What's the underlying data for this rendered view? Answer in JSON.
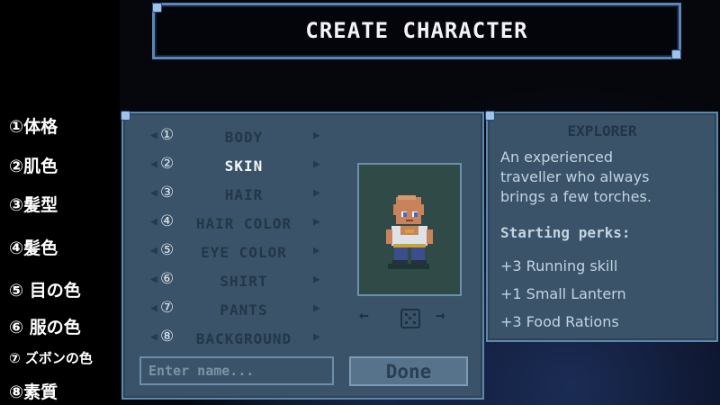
{
  "annotations": [
    "①体格",
    "②肌色",
    "③髪型",
    "④髪色",
    "⑤ 目の色",
    "⑥ 服の色",
    "⑦ ズボンの色",
    "⑧素質"
  ],
  "title": "CREATE CHARACTER",
  "options": [
    {
      "num": "①",
      "label": "BODY",
      "active": false
    },
    {
      "num": "②",
      "label": "SKIN",
      "active": true
    },
    {
      "num": "③",
      "label": "HAIR",
      "active": false
    },
    {
      "num": "④",
      "label": "HAIR COLOR",
      "active": false
    },
    {
      "num": "⑤",
      "label": "EYE COLOR",
      "active": false
    },
    {
      "num": "⑥",
      "label": "SHIRT",
      "active": false
    },
    {
      "num": "⑦",
      "label": "PANTS",
      "active": false
    },
    {
      "num": "⑧",
      "label": "BACKGROUND",
      "active": false
    }
  ],
  "arrows": {
    "left": "◀",
    "right": "▶"
  },
  "preview_controls": {
    "prev": "←",
    "next": "→",
    "randomize_icon": "dice-icon"
  },
  "name_input": {
    "placeholder": "Enter name...",
    "value": ""
  },
  "done_label": "Done",
  "info": {
    "title": "EXPLORER",
    "description_lines": [
      "An experienced",
      "traveller who always",
      "brings a few torches."
    ],
    "perks_title": "Starting perks:",
    "perks": [
      "+3 Running skill",
      "+1 Small Lantern",
      "+3 Food Rations"
    ]
  },
  "colors": {
    "panel": "#3a5368",
    "panel_border": "#5f87ab",
    "preview_bg": "#2f4a47",
    "text_light": "#c3d3e1",
    "text_dark": "#223446"
  }
}
